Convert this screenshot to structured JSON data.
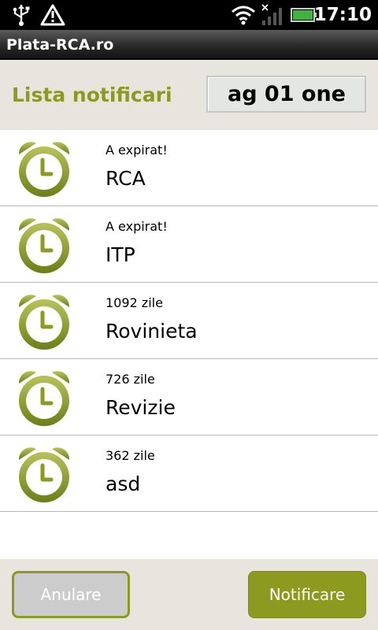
{
  "status_bar": {
    "time": "17:10",
    "icons": [
      "usb-icon",
      "warning-icon",
      "wifi-icon",
      "signal-icon",
      "battery-icon"
    ]
  },
  "app": {
    "title": "Plata-RCA.ro"
  },
  "header": {
    "title": "Lista notificari",
    "plate_value": "ag 01 one"
  },
  "notifications": [
    {
      "status": "A expirat!",
      "name": "RCA"
    },
    {
      "status": "A expirat!",
      "name": "ITP"
    },
    {
      "status": "1092 zile",
      "name": "Rovinieta"
    },
    {
      "status": "726 zile",
      "name": "Revizie"
    },
    {
      "status": "362 zile",
      "name": "asd"
    }
  ],
  "footer": {
    "cancel_label": "Anulare",
    "notify_label": "Notificare"
  },
  "colors": {
    "accent": "#8c9a1f",
    "header_bg": "#e8e5df",
    "status_bar_bg": "#000000"
  }
}
